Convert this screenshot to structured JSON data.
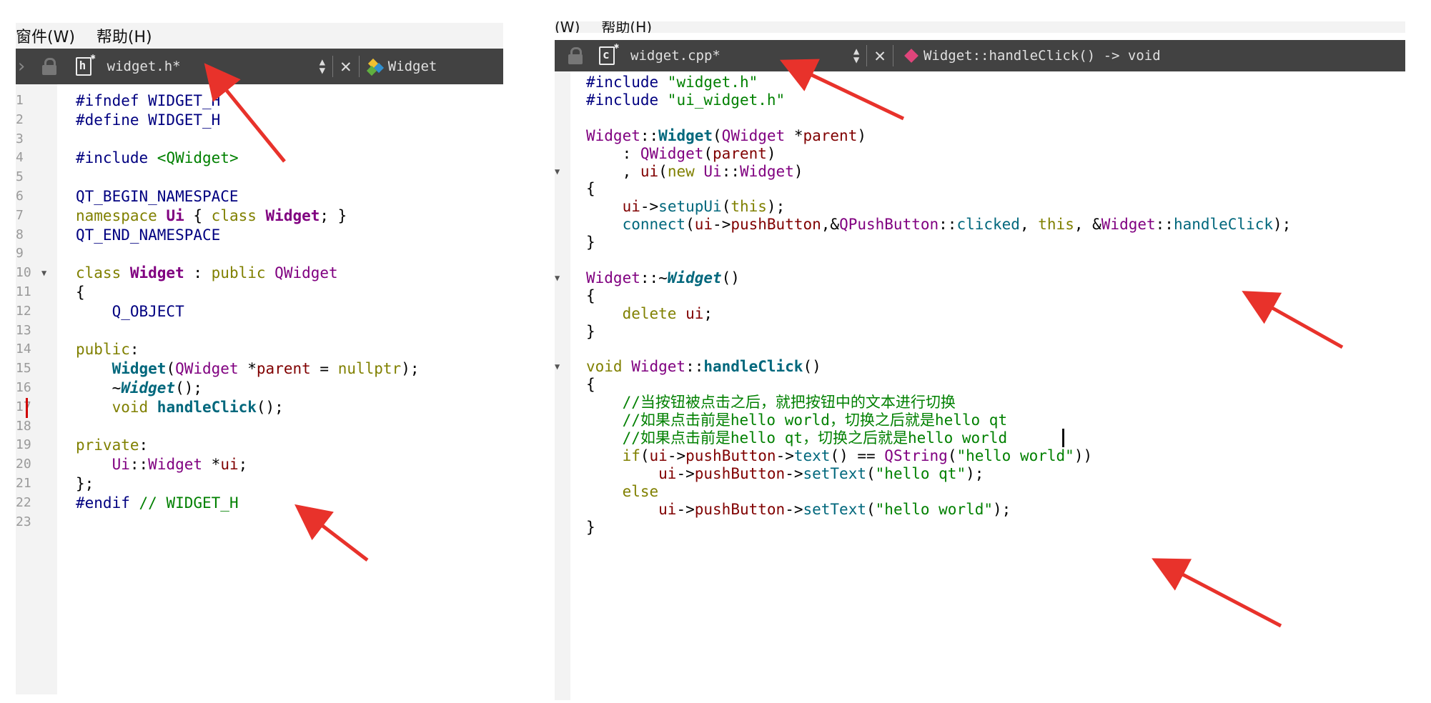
{
  "left": {
    "menu": [
      "窗件(W)",
      "帮助(H)"
    ],
    "toolbar": {
      "file_name": "widget.h*",
      "symbol": "Widget"
    },
    "line_numbers": [
      "1",
      "2",
      "3",
      "4",
      "5",
      "6",
      "7",
      "8",
      "9",
      "10",
      "11",
      "12",
      "13",
      "14",
      "15",
      "16",
      "17",
      "18",
      "19",
      "20",
      "21",
      "22",
      "23"
    ],
    "code": [
      [
        "#ifndef WIDGET_H"
      ],
      [
        "#define WIDGET_H"
      ],
      [
        ""
      ],
      [
        "#include ",
        "<QWidget>"
      ],
      [
        ""
      ],
      [
        "QT_BEGIN_NAMESPACE"
      ],
      [
        "namespace ",
        "Ui",
        " { ",
        "class ",
        "Widget",
        "; }"
      ],
      [
        "QT_END_NAMESPACE"
      ],
      [
        ""
      ],
      [
        "class ",
        "Widget",
        " : ",
        "public ",
        "QWidget"
      ],
      [
        "{"
      ],
      [
        "    Q_OBJECT"
      ],
      [
        ""
      ],
      [
        "public",
        ":"
      ],
      [
        "    ",
        "Widget",
        "(",
        "QWidget",
        " *",
        "parent",
        " = ",
        "nullptr",
        ");"
      ],
      [
        "    ~",
        "Widget",
        "();"
      ],
      [
        "    ",
        "void ",
        "handleClick",
        "();"
      ],
      [
        ""
      ],
      [
        "private",
        ":"
      ],
      [
        "    ",
        "Ui",
        "::",
        "Widget",
        " *",
        "ui",
        ";"
      ],
      [
        "};"
      ],
      [
        "#endif ",
        "// WIDGET_H"
      ],
      [
        ""
      ]
    ]
  },
  "right": {
    "menu": [
      "(W)",
      "帮助(H)"
    ],
    "toolbar": {
      "file_name": "widget.cpp*",
      "symbol": "Widget::handleClick() -> void"
    },
    "code": [
      [
        "#include ",
        "\"widget.h\""
      ],
      [
        "#include ",
        "\"ui_widget.h\""
      ],
      [
        ""
      ],
      [
        "Widget",
        "::",
        "Widget",
        "(",
        "QWidget",
        " *",
        "parent",
        ")"
      ],
      [
        "    : ",
        "QWidget",
        "(",
        "parent",
        ")"
      ],
      [
        "    , ",
        "ui",
        "(",
        "new ",
        "Ui",
        "::",
        "Widget",
        ")"
      ],
      [
        "{"
      ],
      [
        "    ",
        "ui",
        "->",
        "setupUi",
        "(",
        "this",
        ");"
      ],
      [
        "    ",
        "connect",
        "(",
        "ui",
        "->",
        "pushButton",
        ",&",
        "QPushButton",
        "::",
        "clicked",
        ", ",
        "this",
        ", &",
        "Widget",
        "::",
        "handleClick",
        ");"
      ],
      [
        "}"
      ],
      [
        ""
      ],
      [
        "Widget",
        "::~",
        "Widget",
        "()"
      ],
      [
        "{"
      ],
      [
        "    ",
        "delete ",
        "ui",
        ";"
      ],
      [
        "}"
      ],
      [
        ""
      ],
      [
        "void ",
        "Widget",
        "::",
        "handleClick",
        "()"
      ],
      [
        "{"
      ],
      [
        "    ",
        "//当按钮被点击之后，就把按钮中的文本进行切换"
      ],
      [
        "    ",
        "//如果点击前是hello world，切换之后就是hello qt"
      ],
      [
        "    ",
        "//如果点击前是hello qt，切换之后就是hello world"
      ],
      [
        "    ",
        "if",
        "(",
        "ui",
        "->",
        "pushButton",
        "->",
        "text",
        "() == ",
        "QString",
        "(",
        "\"hello world\"",
        "))"
      ],
      [
        "        ",
        "ui",
        "->",
        "pushButton",
        "->",
        "setText",
        "(",
        "\"hello qt\"",
        ");"
      ],
      [
        "    ",
        "else"
      ],
      [
        "        ",
        "ui",
        "->",
        "pushButton",
        "->",
        "setText",
        "(",
        "\"hello world\"",
        ");"
      ],
      [
        "}"
      ]
    ]
  },
  "colors": {
    "keyword": "#808000",
    "preprocessor": "#000080",
    "string": "#008000",
    "comment": "#008000",
    "type": "#800080",
    "function": "#00677c",
    "member": "#800000",
    "toolbar_bg": "#424242",
    "arrow": "#e8322b"
  },
  "icons": [
    "lock-icon",
    "header-file-icon",
    "cpp-file-icon",
    "up-down-icon",
    "close-icon",
    "class-icon",
    "method-icon",
    "fold-arrow-icon"
  ]
}
